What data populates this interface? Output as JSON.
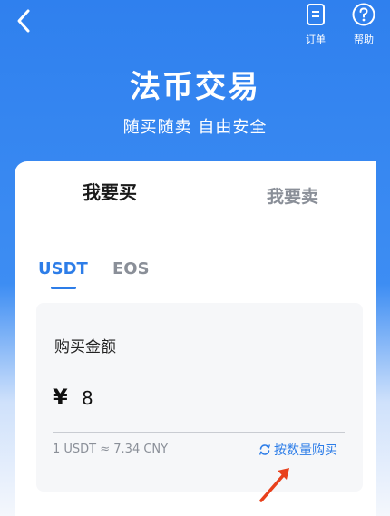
{
  "header": {
    "back_icon": "chevron-left-icon",
    "order_label": "订单",
    "order_icon": "document-icon",
    "help_label": "帮助",
    "help_icon": "question-circle-icon"
  },
  "hero": {
    "title": "法币交易",
    "subtitle": "随买随卖 自由安全"
  },
  "tabs": {
    "buy": "我要买",
    "sell": "我要卖",
    "active": "buy"
  },
  "coins": {
    "items": [
      "USDT",
      "EOS"
    ],
    "active": "USDT"
  },
  "form": {
    "amount_label": "购买金额",
    "currency_symbol": "¥",
    "amount_value": "8",
    "rate_text": "1 USDT ≈ 7.34 CNY",
    "switch_label": "按数量购买",
    "switch_icon": "refresh-icon"
  },
  "colors": {
    "accent": "#2d7de8",
    "annotation": "#e8401c"
  }
}
